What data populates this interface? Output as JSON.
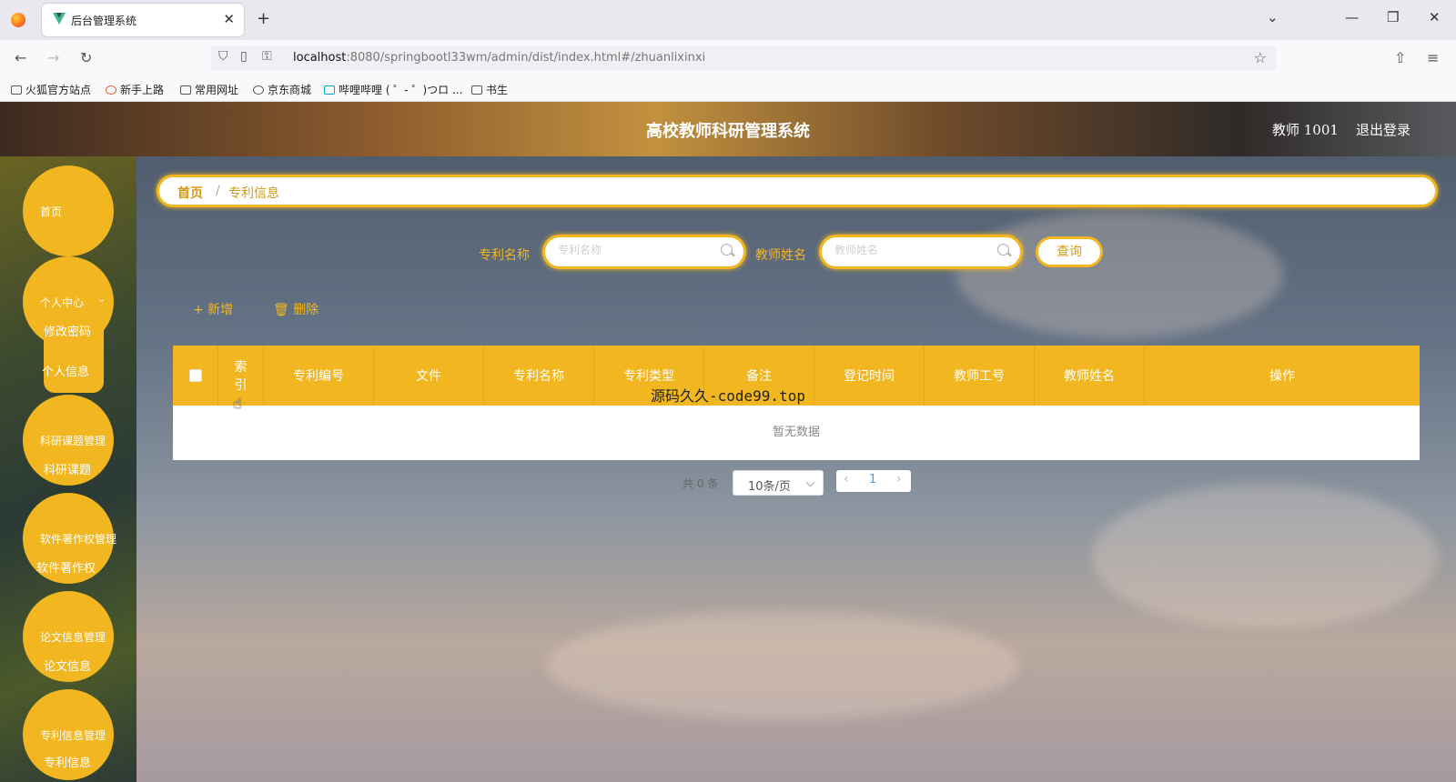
{
  "browser": {
    "tab_title": "后台管理系统",
    "tab_close": "✕",
    "new_tab": "+",
    "url_host": "localhost",
    "url_path": ":8080/springbootl33wm/admin/dist/index.html#/zhuanlixinxi",
    "bookmarks": [
      "火狐官方站点",
      "新手上路",
      "常用网址",
      "京东商城",
      "哔哩哔哩 ( ゜- ゜)つロ ...",
      "书生"
    ]
  },
  "app": {
    "title": "高校教师科研管理系统",
    "user": "教师 1001",
    "logout": "退出登录"
  },
  "sidebar": {
    "home": "首页",
    "personal_center": "个人中心",
    "change_password": "修改密码",
    "personal_info": "个人信息",
    "project_mgmt": "科研课题管理",
    "project": "科研课题",
    "software_mgmt": "软件著作权管理",
    "software": "软件著作权",
    "paper_mgmt": "论文信息管理",
    "paper": "论文信息",
    "patent_mgmt": "专利信息管理",
    "patent": "专利信息"
  },
  "breadcrumb": {
    "home": "首页",
    "sep": "/",
    "current": "专利信息"
  },
  "search": {
    "patent_name_label": "专利名称",
    "patent_name_placeholder": "专利名称",
    "teacher_name_label": "教师姓名",
    "teacher_name_placeholder": "教师姓名",
    "query_button": "查询"
  },
  "actions": {
    "add": "+ 新增",
    "delete": "🗑 删除"
  },
  "table": {
    "columns": [
      "索引",
      "专利编号",
      "文件",
      "专利名称",
      "专利类型",
      "备注",
      "登记时间",
      "教师工号",
      "教师姓名",
      "操作"
    ],
    "empty_text": "暂无数据"
  },
  "overlay_text": "源码久久-code99.top",
  "pagination": {
    "total": "共 0 条",
    "page_size": "10条/页",
    "current_page": "1"
  },
  "colors": {
    "accent": "#f2b620",
    "accent_text": "#d39a16"
  }
}
